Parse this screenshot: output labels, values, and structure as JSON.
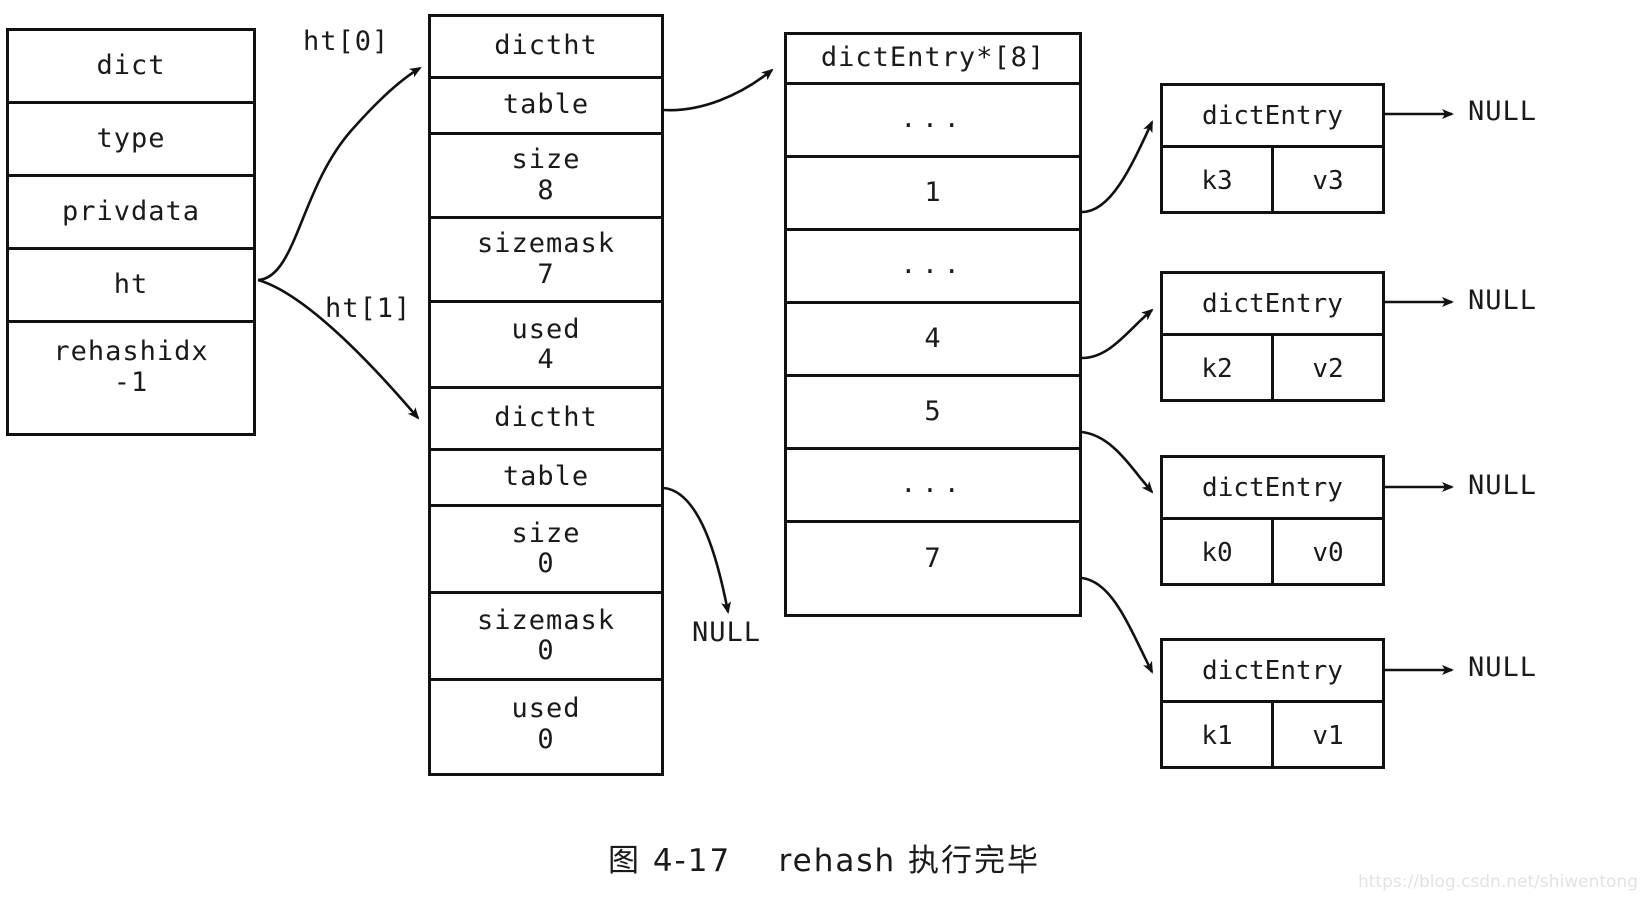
{
  "caption": "图 4-17    rehash 执行完毕",
  "watermark": "https://blog.csdn.net/shiwentong",
  "dict": {
    "title": "dict",
    "fields": [
      {
        "name": "type",
        "value": ""
      },
      {
        "name": "privdata",
        "value": ""
      },
      {
        "name": "ht",
        "value": ""
      },
      {
        "name": "rehashidx",
        "value": "-1"
      }
    ]
  },
  "pointer_labels": {
    "ht0": "ht[0]",
    "ht1": "ht[1]"
  },
  "ht0": {
    "title": "dictht",
    "fields": [
      {
        "name": "table",
        "value": ""
      },
      {
        "name": "size",
        "value": "8"
      },
      {
        "name": "sizemask",
        "value": "7"
      },
      {
        "name": "used",
        "value": "4"
      }
    ]
  },
  "ht1": {
    "title": "dictht",
    "fields": [
      {
        "name": "table",
        "value": ""
      },
      {
        "name": "size",
        "value": "0"
      },
      {
        "name": "sizemask",
        "value": "0"
      },
      {
        "name": "used",
        "value": "0"
      }
    ],
    "table_target": "NULL"
  },
  "bucket_array": {
    "title": "dictEntry*[8]",
    "slots": [
      {
        "label": "...",
        "kind": "ellipsis"
      },
      {
        "label": "1",
        "kind": "index"
      },
      {
        "label": "...",
        "kind": "ellipsis"
      },
      {
        "label": "4",
        "kind": "index"
      },
      {
        "label": "5",
        "kind": "index"
      },
      {
        "label": "...",
        "kind": "ellipsis"
      },
      {
        "label": "7",
        "kind": "index"
      }
    ]
  },
  "entries": [
    {
      "title": "dictEntry",
      "key": "k3",
      "value": "v3",
      "next": "NULL"
    },
    {
      "title": "dictEntry",
      "key": "k2",
      "value": "v2",
      "next": "NULL"
    },
    {
      "title": "dictEntry",
      "key": "k0",
      "value": "v0",
      "next": "NULL"
    },
    {
      "title": "dictEntry",
      "key": "k1",
      "value": "v1",
      "next": "NULL"
    }
  ],
  "colors": {
    "stroke": "#111111",
    "background": "#ffffff",
    "watermark": "#e2e2e2"
  }
}
